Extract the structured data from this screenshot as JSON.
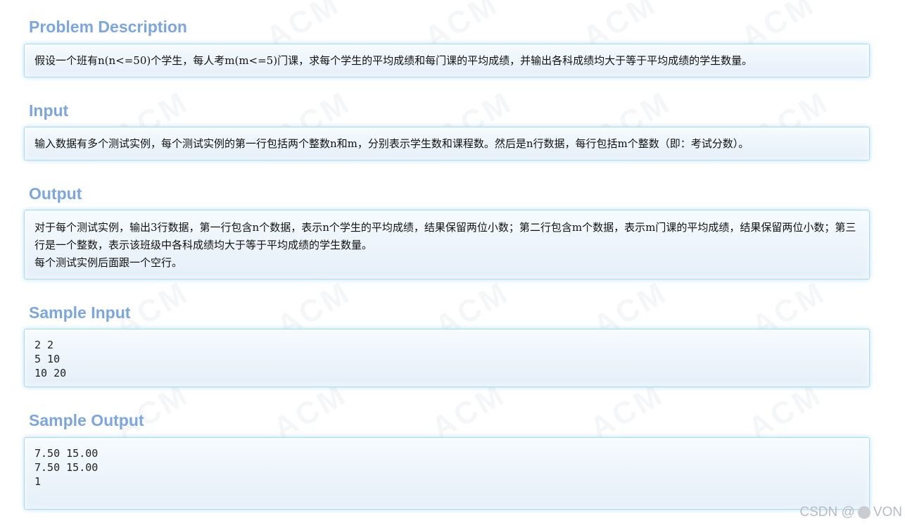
{
  "sections": {
    "problem": {
      "title": "Problem Description",
      "text": "假设一个班有n(n<=50)个学生，每人考m(m<=5)门课，求每个学生的平均成绩和每门课的平均成绩，并输出各科成绩均大于等于平均成绩的学生数量。"
    },
    "input": {
      "title": "Input",
      "text": "输入数据有多个测试实例，每个测试实例的第一行包括两个整数n和m，分别表示学生数和课程数。然后是n行数据，每行包括m个整数（即：考试分数）。"
    },
    "output": {
      "title": "Output",
      "line1": "对于每个测试实例，输出3行数据，第一行包含n个数据，表示n个学生的平均成绩，结果保留两位小数；第二行包含m个数据，表示m门课的平均成绩，结果保留两位小数；第三行是一个整数，表示该班级中各科成绩均大于等于平均成绩的学生数量。",
      "line2": "每个测试实例后面跟一个空行。"
    },
    "sample_input": {
      "title": "Sample Input",
      "lines": [
        "2 2",
        "5 10",
        "10 20"
      ]
    },
    "sample_output": {
      "title": "Sample Output",
      "lines": [
        "7.50 15.00",
        "7.50 15.00",
        "1"
      ]
    }
  },
  "watermark": {
    "text": "ACM"
  },
  "credit": {
    "prefix": "CSDN @",
    "suffix": "VON",
    "icon": "avatar-circle-icon"
  }
}
